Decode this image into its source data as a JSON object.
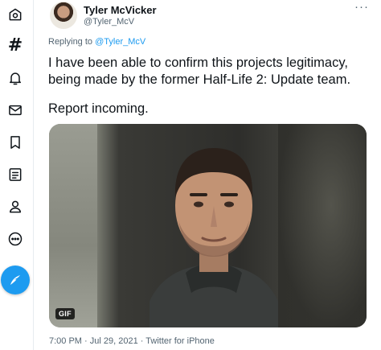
{
  "sidebar": {
    "items": [
      {
        "name": "explore-icon"
      },
      {
        "name": "hashtag-icon",
        "glyph": "#"
      },
      {
        "name": "notifications-bell-icon"
      },
      {
        "name": "messages-mail-icon"
      },
      {
        "name": "bookmark-icon"
      },
      {
        "name": "lists-icon"
      },
      {
        "name": "profile-user-icon"
      },
      {
        "name": "more-circle-icon"
      }
    ],
    "compose": {
      "name": "compose-tweet-icon",
      "color": "#1d9bf0"
    }
  },
  "tweet": {
    "author": {
      "display_name": "Tyler McVicker",
      "handle": "@Tyler_McV"
    },
    "more_glyph": "···",
    "reply": {
      "prefix": "Replying to",
      "handle": "@Tyler_McV"
    },
    "text": {
      "line1": "I have been able to confirm this projects legitimacy,",
      "line2": "being made by the former Half-Life 2: Update team.",
      "line3": "Report incoming."
    },
    "media": {
      "badge": "GIF"
    },
    "meta": {
      "time": "7:00 PM",
      "separator": "·",
      "date": "Jul 29, 2021",
      "source": "Twitter for iPhone"
    }
  },
  "colors": {
    "accent": "#1d9bf0",
    "text": "#0f1419",
    "secondary": "#536471"
  }
}
